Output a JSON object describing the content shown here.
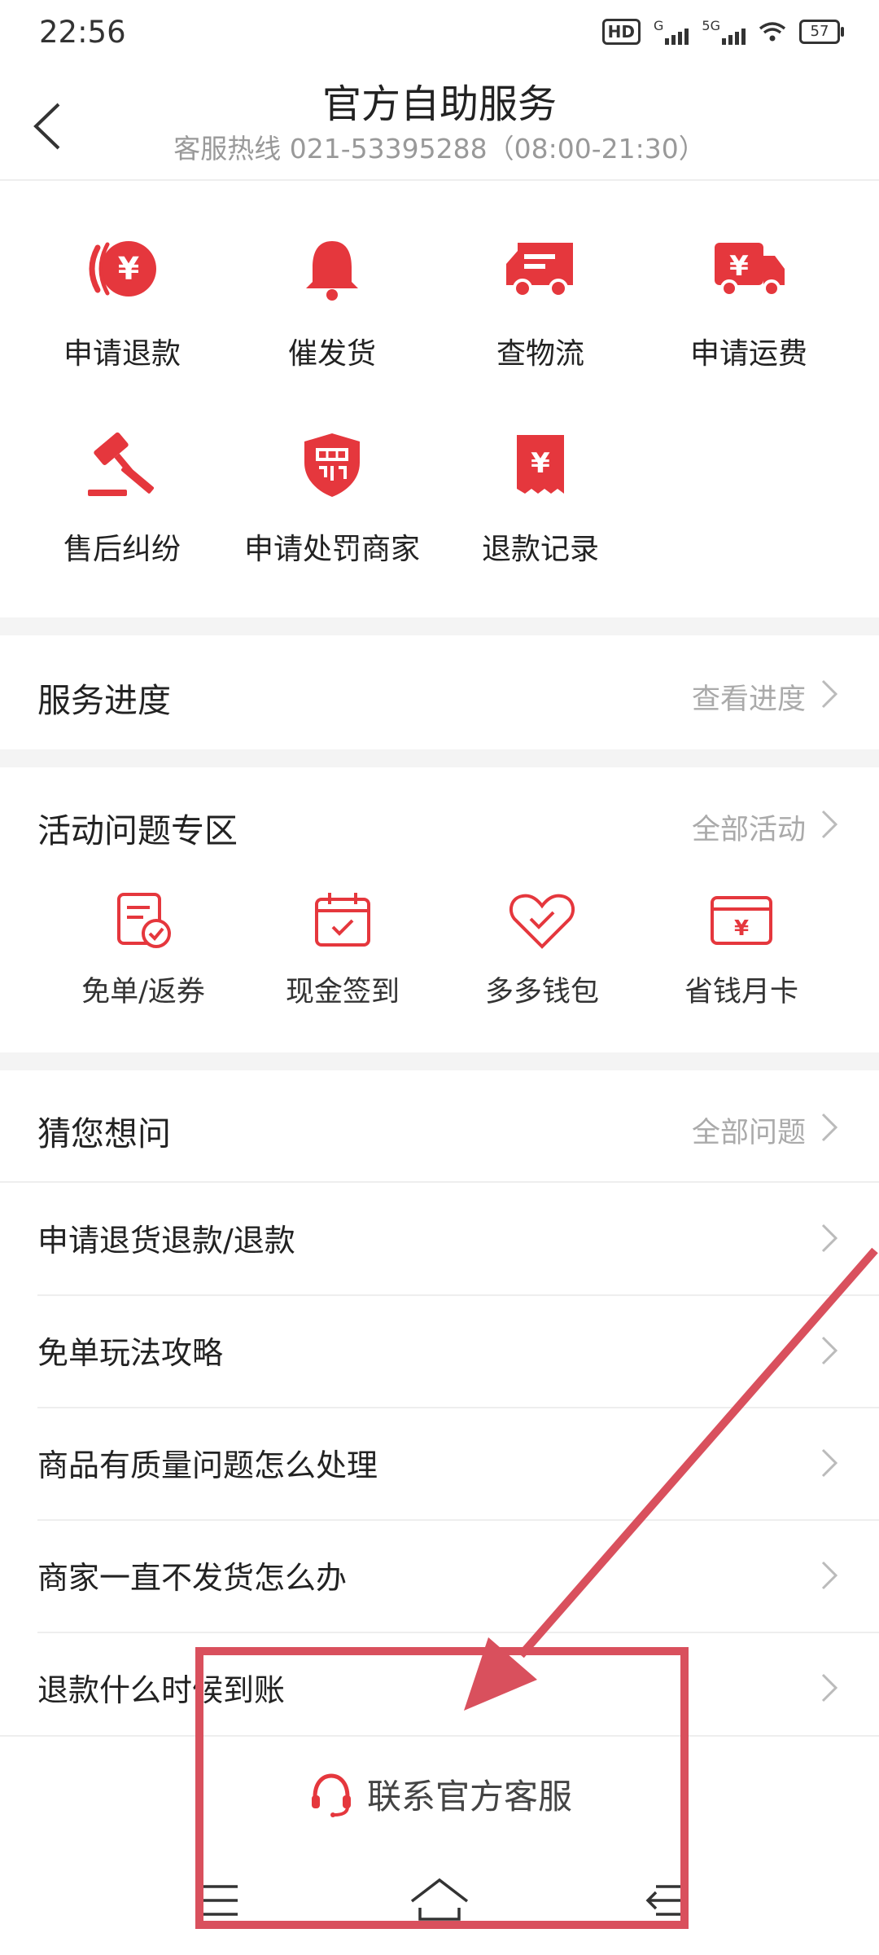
{
  "status_bar": {
    "time": "22:56",
    "hd": "HD",
    "sim1": "G",
    "sim2": "5G",
    "battery": "57"
  },
  "header": {
    "title": "官方自助服务",
    "subtitle": "客服热线 021-53395288（08:00-21:30）"
  },
  "services": [
    {
      "label": "申请退款",
      "icon": "refund-icon"
    },
    {
      "label": "催发货",
      "icon": "bell-icon"
    },
    {
      "label": "查物流",
      "icon": "truck-icon"
    },
    {
      "label": "申请运费",
      "icon": "freight-truck-icon"
    },
    {
      "label": "售后纠纷",
      "icon": "gavel-icon"
    },
    {
      "label": "申请处罚商家",
      "icon": "penalty-shield-icon"
    },
    {
      "label": "退款记录",
      "icon": "receipt-icon"
    }
  ],
  "progress": {
    "title": "服务进度",
    "link": "查看进度"
  },
  "activities": {
    "title": "活动问题专区",
    "link": "全部活动",
    "items": [
      {
        "label": "免单/返券",
        "icon": "coupon-check-icon"
      },
      {
        "label": "现金签到",
        "icon": "calendar-check-icon"
      },
      {
        "label": "多多钱包",
        "icon": "heart-check-icon"
      },
      {
        "label": "省钱月卡",
        "icon": "card-yen-icon"
      }
    ]
  },
  "faq": {
    "title": "猜您想问",
    "link": "全部问题",
    "items": [
      "申请退货退款/退款",
      "免单玩法攻略",
      "商品有质量问题怎么处理",
      "商家一直不发货怎么办",
      "退款什么时候到账"
    ]
  },
  "contact": {
    "label": "联系官方客服",
    "icon": "headset-icon"
  },
  "colors": {
    "accent": "#e02e24",
    "annotation": "#d9505d"
  }
}
